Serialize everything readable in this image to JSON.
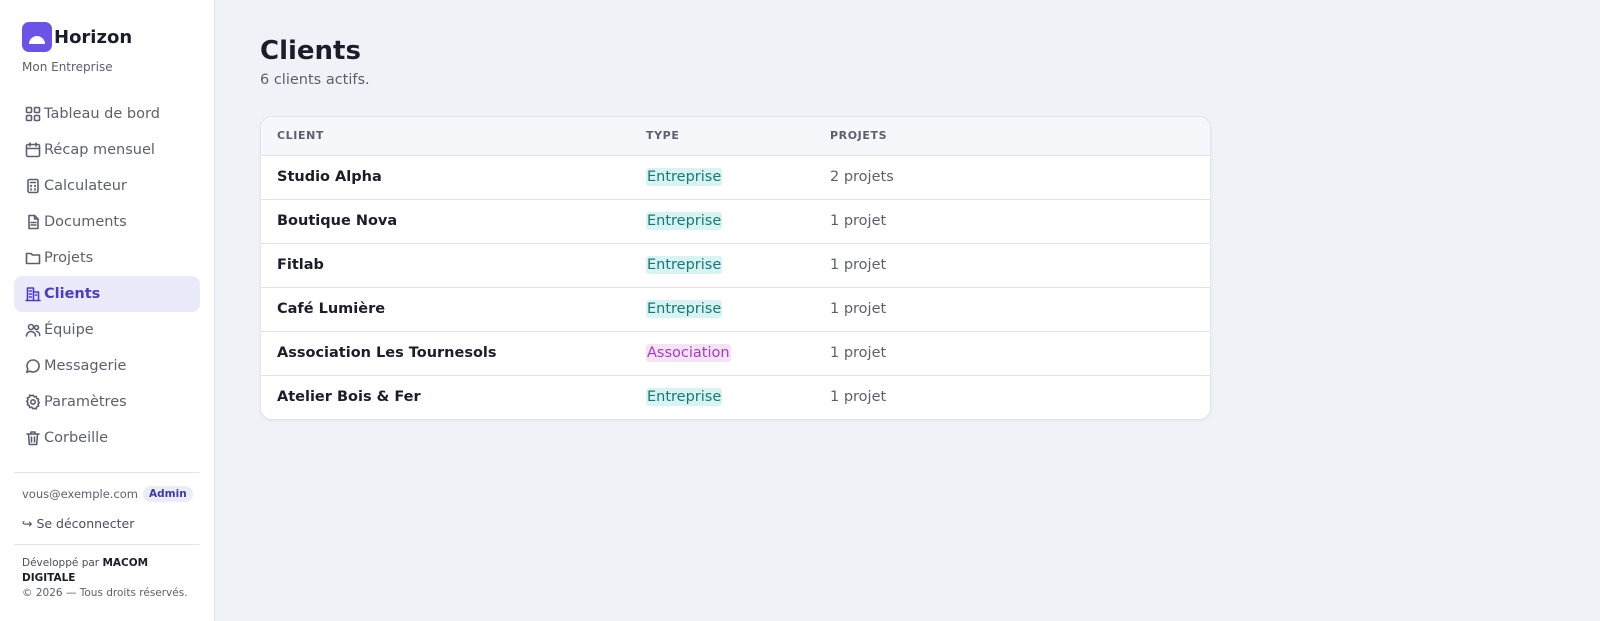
{
  "brand": {
    "name": "Horizon",
    "subtitle": "Mon Entreprise"
  },
  "sidebar": {
    "items": [
      {
        "label": "Tableau de bord",
        "icon": "dashboard-grid-icon",
        "active": false
      },
      {
        "label": "Récap mensuel",
        "icon": "calendar-icon",
        "active": false
      },
      {
        "label": "Calculateur",
        "icon": "calculator-icon",
        "active": false
      },
      {
        "label": "Documents",
        "icon": "document-icon",
        "active": false
      },
      {
        "label": "Projets",
        "icon": "folder-icon",
        "active": false
      },
      {
        "label": "Clients",
        "icon": "building-icon",
        "active": true
      },
      {
        "label": "Équipe",
        "icon": "users-icon",
        "active": false
      },
      {
        "label": "Messagerie",
        "icon": "message-icon",
        "active": false
      },
      {
        "label": "Paramètres",
        "icon": "gear-icon",
        "active": false
      },
      {
        "label": "Corbeille",
        "icon": "trash-icon",
        "active": false
      }
    ]
  },
  "account": {
    "email": "vous@exemple.com",
    "role": "Admin",
    "logout_label": "↪ Se déconnecter"
  },
  "footer": {
    "developed_by_prefix": "Développé par",
    "developer": "MACOM DIGITALE",
    "copyright": "© 2026 — Tous droits réservés."
  },
  "page": {
    "title": "Clients",
    "subtitle": "6 clients actifs."
  },
  "table": {
    "headers": {
      "client": "CLIENT",
      "type": "TYPE",
      "projects": "PROJETS"
    },
    "rows": [
      {
        "client": "Studio Alpha",
        "type": "Entreprise",
        "projects": "2 projets"
      },
      {
        "client": "Boutique Nova",
        "type": "Entreprise",
        "projects": "1 projet"
      },
      {
        "client": "Fitlab",
        "type": "Entreprise",
        "projects": "1 projet"
      },
      {
        "client": "Café Lumière",
        "type": "Entreprise",
        "projects": "1 projet"
      },
      {
        "client": "Association Les Tournesols",
        "type": "Association",
        "projects": "1 projet"
      },
      {
        "client": "Atelier Bois & Fer",
        "type": "Entreprise",
        "projects": "1 projet"
      }
    ]
  },
  "colors": {
    "accent": "#6c52e6",
    "active_bg": "#ebeafb",
    "active_text": "#4a3cc9",
    "entreprise_bg": "#d8f3f1",
    "entreprise_text": "#137a78",
    "association_bg": "#f4e2f7",
    "association_text": "#a23ec0"
  }
}
